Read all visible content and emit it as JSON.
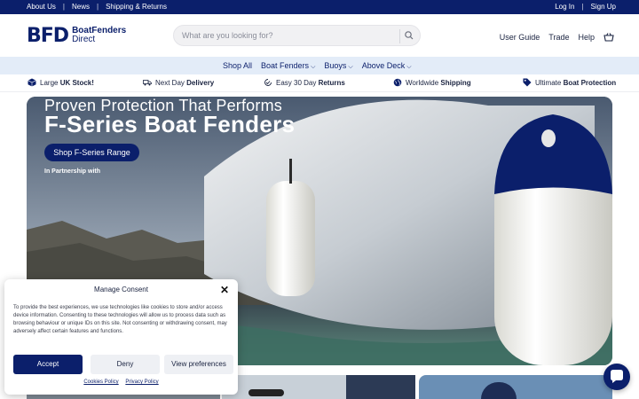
{
  "topbar": {
    "left_links": [
      "About Us",
      "News",
      "Shipping & Returns"
    ],
    "right_links": [
      "Log In",
      "Sign Up"
    ]
  },
  "header": {
    "logo": {
      "mark": "BFD",
      "line1": "BoatFenders",
      "line2": "Direct"
    },
    "search_placeholder": "What are you looking for?",
    "links": [
      "User Guide",
      "Trade",
      "Help"
    ]
  },
  "nav": {
    "items": [
      {
        "label": "Shop All",
        "has_menu": false
      },
      {
        "label": "Boat Fenders",
        "has_menu": true
      },
      {
        "label": "Buoys",
        "has_menu": true
      },
      {
        "label": "Above Deck",
        "has_menu": true
      }
    ]
  },
  "usp": [
    {
      "icon": "box-icon",
      "pre": "Large ",
      "bold": "UK Stock!",
      "post": ""
    },
    {
      "icon": "truck-icon",
      "pre": "Next Day ",
      "bold": "Delivery",
      "post": ""
    },
    {
      "icon": "return-icon",
      "pre": "Easy 30 Day ",
      "bold": "Returns",
      "post": ""
    },
    {
      "icon": "globe-icon",
      "pre": "Worldwide ",
      "bold": "Shipping",
      "post": ""
    },
    {
      "icon": "tag-icon",
      "pre": "Ultimate ",
      "bold": "Boat Protection",
      "post": ""
    }
  ],
  "hero": {
    "title_line1": "Proven Protection That Performs",
    "title_line2": "F-Series Boat Fenders",
    "button": "Shop F-Series Range",
    "partner_text": "In Partnership with"
  },
  "consent": {
    "title": "Manage Consent",
    "body": "To provide the best experiences, we use technologies like cookies to store and/or access device information. Consenting to these technologies will allow us to process data such as browsing behaviour or unique IDs on this site. Not consenting or withdrawing consent, may adversely affect certain features and functions.",
    "accept": "Accept",
    "deny": "Deny",
    "prefs": "View preferences",
    "cookies_policy": "Cookies Policy",
    "privacy_policy": "Privacy Policy"
  },
  "colors": {
    "brand_navy": "#0b1f6b",
    "nav_bg": "#e3ecf8"
  }
}
